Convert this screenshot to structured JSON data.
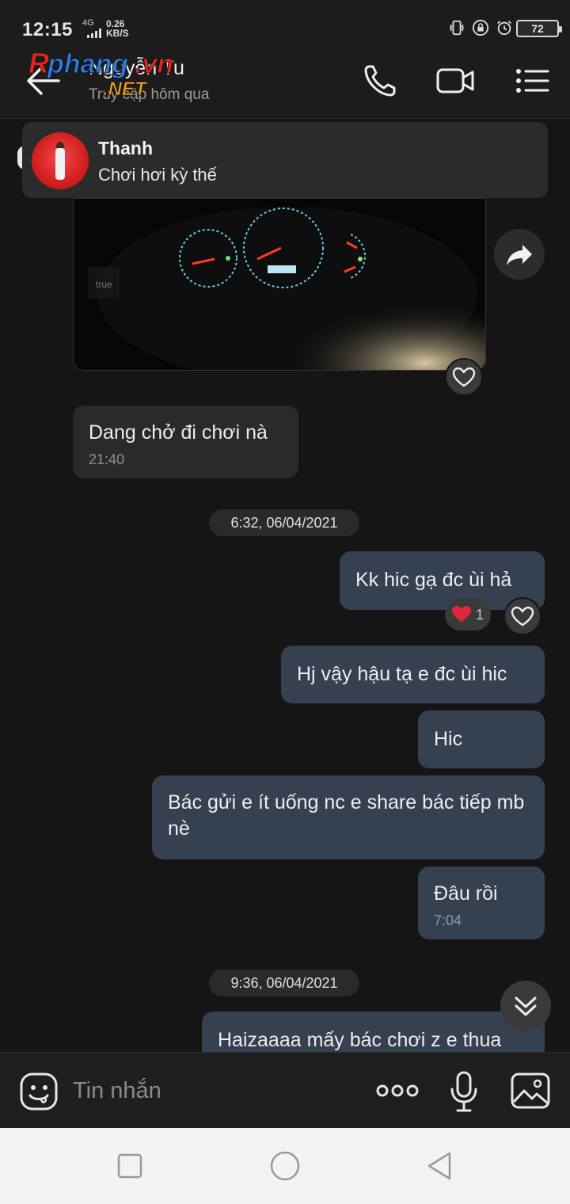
{
  "status_bar": {
    "time": "12:15",
    "network": "4G",
    "speed_value": "0.26",
    "speed_unit": "KB/S",
    "battery": "72"
  },
  "header": {
    "contact_name": "Nguyễn Tu",
    "last_seen": "Truy cập hôm qua",
    "watermark": "Rphang.vn",
    "watermark_sub": ".NET"
  },
  "notification": {
    "sender": "Thanh",
    "message": "Chơi hơi kỳ thế"
  },
  "messages": [
    {
      "side": "in",
      "text": "Dang chở đi chơi nà",
      "time": "21:40"
    },
    {
      "type": "date",
      "text": "6:32, 06/04/2021"
    },
    {
      "side": "out",
      "text": "Kk hic gạ đc ùi hả",
      "reaction_count": "1"
    },
    {
      "side": "out",
      "text": "Hj vậy hậu tạ e đc ùi hic"
    },
    {
      "side": "out",
      "text": "Hic"
    },
    {
      "side": "out",
      "text": "Bác gửi e ít uống nc e share bác tiếp mb nè"
    },
    {
      "side": "out",
      "text": "Đâu rồi",
      "time": "7:04"
    },
    {
      "type": "date",
      "text": "9:36, 06/04/2021"
    },
    {
      "side": "out",
      "text": "Haizaaaa mấy bác chơi z e thua"
    }
  ],
  "input_bar": {
    "placeholder": "Tin nhắn"
  },
  "colors": {
    "background": "#151515",
    "outgoing_bubble": "#354051",
    "incoming_bubble": "#2a2a2a",
    "reaction_heart": "#e3263a"
  },
  "icons": [
    "back-arrow-icon",
    "phone-icon",
    "video-call-icon",
    "menu-list-icon",
    "share-icon",
    "heart-icon",
    "chevron-double-down-icon",
    "emoji-icon",
    "more-dots-icon",
    "mic-icon",
    "gallery-icon",
    "nav-recents-icon",
    "nav-home-icon",
    "nav-back-icon"
  ]
}
